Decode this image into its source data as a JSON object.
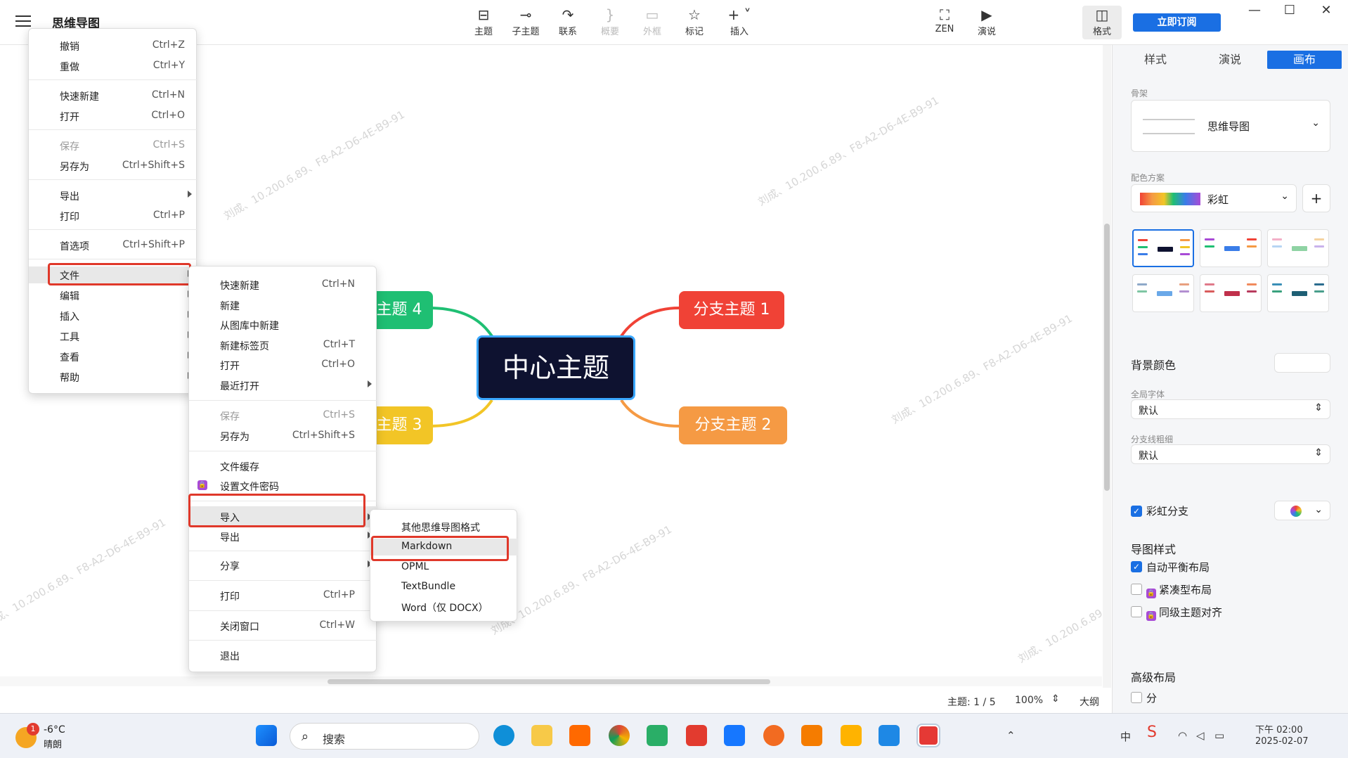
{
  "app": {
    "title": "思维导图"
  },
  "toolbar": {
    "items": [
      {
        "label": "主题",
        "icon": "topic-icon"
      },
      {
        "label": "子主题",
        "icon": "subtopic-icon"
      },
      {
        "label": "联系",
        "icon": "relation-icon"
      },
      {
        "label": "概要",
        "icon": "summary-icon"
      },
      {
        "label": "外框",
        "icon": "boundary-icon"
      },
      {
        "label": "标记",
        "icon": "star-icon"
      },
      {
        "label": "插入",
        "icon": "plus-icon"
      },
      {
        "label": "ZEN",
        "icon": "fullscreen-icon"
      },
      {
        "label": "演说",
        "icon": "present-icon"
      },
      {
        "label": "格式",
        "icon": "format-icon"
      }
    ],
    "subscribe": "立即订阅"
  },
  "canvas": {
    "center": "中心主题",
    "branches": [
      "分支主题 1",
      "分支主题 2",
      "主题 3",
      "主题 4"
    ],
    "branch_colors": {
      "b1": "#f04236",
      "b2": "#f59a44",
      "b3": "#f2c526",
      "b4": "#1fbf73"
    },
    "watermark": "刘成、10.200.6.89、F8-A2-D6-4E-B9-91"
  },
  "status": {
    "topics": "主题: 1 / 5",
    "zoom": "100%",
    "outline": "大纲"
  },
  "panel": {
    "tabs": [
      "样式",
      "演说",
      "画布"
    ],
    "skeleton_label": "骨架",
    "skeleton_value": "思维导图",
    "scheme_label": "配色方案",
    "scheme_value": "彩虹",
    "bg_color_label": "背景颜色",
    "global_font_label": "全局字体",
    "global_font_value": "默认",
    "branch_width_label": "分支线粗细",
    "branch_width_value": "默认",
    "rainbow_branch": "彩虹分支",
    "map_style_head": "导图样式",
    "auto_balance": "自动平衡布局",
    "compact": "紧凑型布局",
    "align_same": "同级主题对齐",
    "adv_layout": "高级布局",
    "partial": "分"
  },
  "menu_main": [
    {
      "label": "撤销",
      "sc": "Ctrl+Z"
    },
    {
      "label": "重做",
      "sc": "Ctrl+Y"
    },
    {
      "label": "快速新建",
      "sc": "Ctrl+N"
    },
    {
      "label": "打开",
      "sc": "Ctrl+O"
    },
    {
      "label": "保存",
      "sc": "Ctrl+S"
    },
    {
      "label": "另存为",
      "sc": "Ctrl+Shift+S"
    },
    {
      "label": "导出",
      "sc": ""
    },
    {
      "label": "打印",
      "sc": "Ctrl+P"
    },
    {
      "label": "首选项",
      "sc": "Ctrl+Shift+P"
    },
    {
      "label": "文件",
      "sc": ""
    },
    {
      "label": "编辑",
      "sc": ""
    },
    {
      "label": "插入",
      "sc": ""
    },
    {
      "label": "工具",
      "sc": ""
    },
    {
      "label": "查看",
      "sc": ""
    },
    {
      "label": "帮助",
      "sc": ""
    }
  ],
  "menu_file": [
    {
      "label": "快速新建",
      "sc": "Ctrl+N"
    },
    {
      "label": "新建",
      "sc": ""
    },
    {
      "label": "从图库中新建",
      "sc": ""
    },
    {
      "label": "新建标签页",
      "sc": "Ctrl+T"
    },
    {
      "label": "打开",
      "sc": "Ctrl+O"
    },
    {
      "label": "最近打开",
      "sc": ""
    },
    {
      "label": "保存",
      "sc": "Ctrl+S"
    },
    {
      "label": "另存为",
      "sc": "Ctrl+Shift+S"
    },
    {
      "label": "文件缓存",
      "sc": ""
    },
    {
      "label": "设置文件密码",
      "sc": ""
    },
    {
      "label": "导入",
      "sc": ""
    },
    {
      "label": "导出",
      "sc": ""
    },
    {
      "label": "分享",
      "sc": ""
    },
    {
      "label": "打印",
      "sc": "Ctrl+P"
    },
    {
      "label": "关闭窗口",
      "sc": "Ctrl+W"
    },
    {
      "label": "退出",
      "sc": ""
    }
  ],
  "menu_import": [
    "其他思维导图格式",
    "Markdown",
    "OPML",
    "TextBundle",
    "Word（仅 DOCX）"
  ],
  "taskbar": {
    "temp": "-6°C",
    "weather": "晴朗",
    "badge": "1",
    "search": "搜索",
    "ime": "中",
    "time": "下午 02:00",
    "date": "2025-02-07"
  }
}
